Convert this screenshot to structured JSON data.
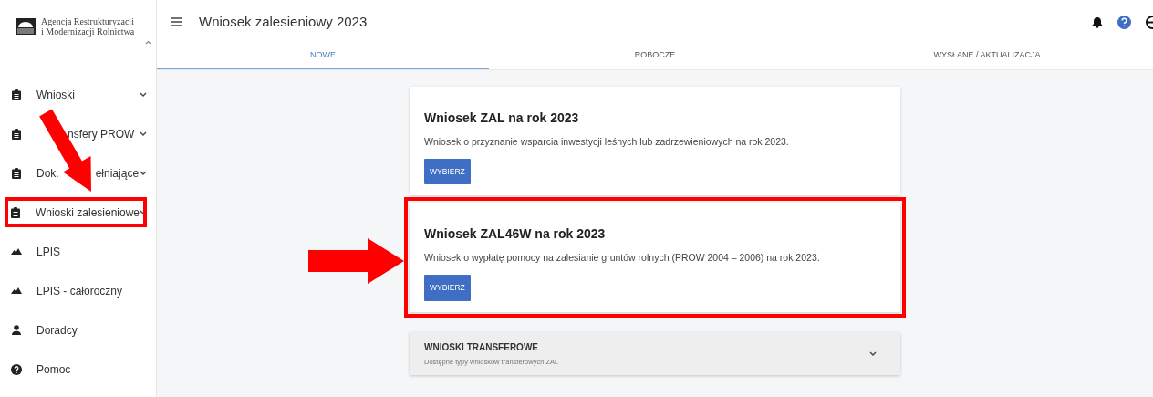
{
  "logo": {
    "lines": [
      "Agencja Restrukturyzacji",
      "i Modernizacji Rolnictwa"
    ]
  },
  "header": {
    "title": "Wniosek zalesieniowy 2023"
  },
  "sidebar": {
    "items": [
      {
        "parts": [
          "Wnioski"
        ],
        "kind": "clipboard",
        "expandable": true,
        "highlighted": false
      },
      {
        "parts": [
          "nsfery PROW"
        ],
        "gap_before": true,
        "kind": "clipboard",
        "expandable": true,
        "highlighted": false
      },
      {
        "parts": [
          "Dok.",
          "ełniające"
        ],
        "kind": "clipboard",
        "expandable": true,
        "highlighted": false
      },
      {
        "parts": [
          "Wnioski zalesieniowe"
        ],
        "kind": "clipboard",
        "expandable": true,
        "highlighted": true
      },
      {
        "parts": [
          "LPIS"
        ],
        "kind": "terrain",
        "expandable": false,
        "highlighted": false
      },
      {
        "parts": [
          "LPIS - całoroczny"
        ],
        "kind": "terrain",
        "expandable": false,
        "highlighted": false
      },
      {
        "parts": [
          "Doradcy"
        ],
        "kind": "person",
        "expandable": false,
        "highlighted": false
      },
      {
        "parts": [
          "Pomoc"
        ],
        "kind": "help",
        "expandable": false,
        "highlighted": false
      }
    ]
  },
  "tabs": [
    {
      "label": "NOWE",
      "selected": true
    },
    {
      "label": "ROBOCZE",
      "selected": false
    },
    {
      "label": "WYSŁANE / AKTUALIZACJA",
      "selected": false
    }
  ],
  "cards": [
    {
      "title": "Wniosek ZAL na rok 2023",
      "text": "Wniosek o przyznanie wsparcia inwestycji leśnych lub zadrzewieniowych na rok 2023.",
      "button": "WYBIERZ",
      "highlighted": false
    },
    {
      "title": "Wniosek ZAL46W na rok 2023",
      "text": "Wniosek o wypłatę pomocy na zalesianie gruntów rolnych (PROW 2004 – 2006) na rok 2023.",
      "button": "WYBIERZ",
      "highlighted": true
    }
  ],
  "accordion": {
    "title": "WNIOSKI TRANSFEROWE",
    "subtitle": "Dostępne typy wniosków transferowych ZAL",
    "expanded": false
  },
  "annotation_arrows": [
    {
      "kind": "diagonal"
    },
    {
      "kind": "horizontal"
    }
  ]
}
